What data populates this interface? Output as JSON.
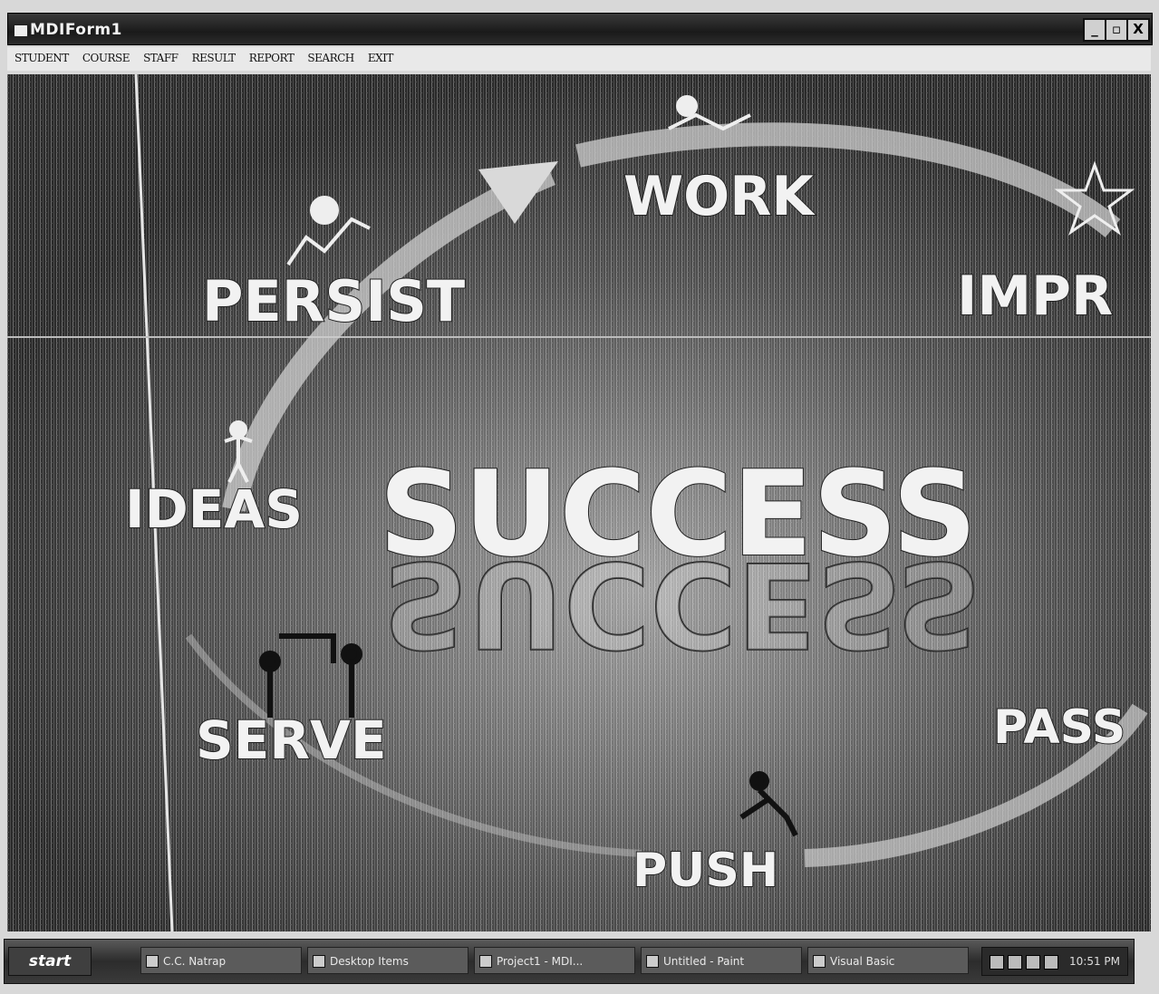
{
  "window": {
    "title": "MDIForm1",
    "minimize_label": "_",
    "maximize_label": "▫",
    "close_label": "X"
  },
  "menu": {
    "items": [
      {
        "label": "STUDENT"
      },
      {
        "label": "COURSE"
      },
      {
        "label": "STAFF"
      },
      {
        "label": "RESULT"
      },
      {
        "label": "REPORT"
      },
      {
        "label": "SEARCH"
      },
      {
        "label": "EXIT"
      }
    ]
  },
  "background_image": {
    "center_word": "SUCCESS",
    "words": {
      "work": "WORK",
      "improve": "IMPR",
      "persist": "PERSIST",
      "ideas": "IDEAS",
      "serve": "SERVE",
      "push": "PUSH",
      "pass": "PASS"
    }
  },
  "taskbar": {
    "start_label": "start",
    "tasks": [
      {
        "label": "C.C. Natrap"
      },
      {
        "label": "Desktop Items"
      },
      {
        "label": "Project1 - MDI..."
      },
      {
        "label": "Untitled - Paint"
      },
      {
        "label": "Visual Basic"
      }
    ],
    "clock": "10:51 PM"
  },
  "colors": {
    "titlebar": "#1a1a1a",
    "menubar": "#e9e9e9",
    "client_background": "#1a1a1a",
    "taskbar": "#3a3a3a"
  }
}
